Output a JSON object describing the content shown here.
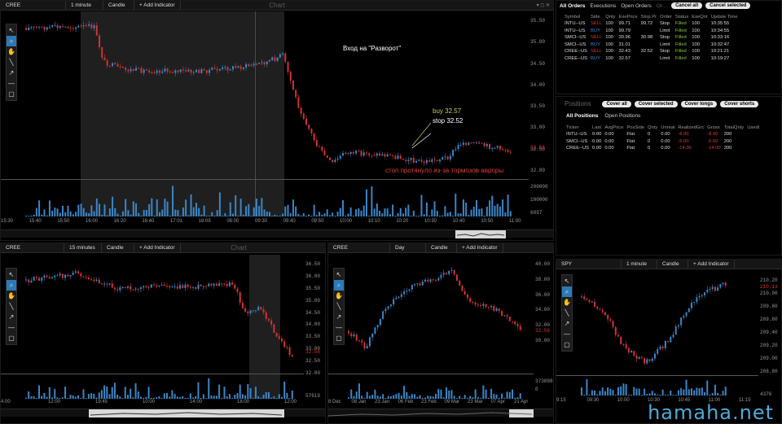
{
  "main_chart": {
    "symbol": "CREE",
    "interval": "1 minute",
    "type": "Candle",
    "add_indicator": "+ Add Indicator",
    "title": "Chart",
    "y_ticks": [
      "35.50",
      "35.00",
      "34.50",
      "34.00",
      "33.50",
      "33.00",
      "32.50",
      "32.00"
    ],
    "last_price": "32.56",
    "vol_ticks": [
      "200000",
      "100000"
    ],
    "vol_last": "6897",
    "x_ticks": [
      "15:30",
      "15:40",
      "15:50",
      "16:00",
      "16:20",
      "16:40",
      "17:01",
      "18:09",
      "08:00",
      "09:30",
      "09:40",
      "09:50",
      "10:00",
      "10:10",
      "10:20",
      "10:30",
      "10:40",
      "10:50",
      "11:00"
    ],
    "annotation_entry": "Вход на \"Разворот\"",
    "annotation_buy": "buy 32.57",
    "annotation_stop": "stop 32.52",
    "annotation_slip": "стоп протянуло из-за тормозов авроры"
  },
  "chart_15m": {
    "symbol": "CREE",
    "interval": "15 minutes",
    "type": "Candle",
    "add_indicator": "+ Add Indicator",
    "title": "Chart",
    "y_ticks": [
      "36.50",
      "36.00",
      "35.50",
      "35.00",
      "34.50",
      "34.00",
      "33.50",
      "33.00",
      "32.50",
      "32.00"
    ],
    "last_price": "32.56",
    "vol_last": "57619",
    "x_ticks": [
      "4:00",
      "12:00",
      "19:45",
      "10:00",
      "14:00",
      "18:00",
      "12:00"
    ]
  },
  "chart_day": {
    "symbol": "CREE",
    "interval": "Day",
    "type": "Candle",
    "add_indicator": "+ Add Indicator",
    "y_ticks": [
      "40.00",
      "38.00",
      "36.00",
      "34.00",
      "32.00",
      "30.00"
    ],
    "last_price": "32.56",
    "vol_ticks": [
      "3738985",
      "0"
    ],
    "x_ticks": [
      "8 Dec",
      "08 Jan",
      "23 Jan",
      "06 Feb",
      "23 Feb",
      "09 Mar",
      "23 Mar",
      "07 Apr",
      "21 Apr"
    ]
  },
  "chart_spy": {
    "symbol": "SPY",
    "interval": "1 minute",
    "type": "Candle",
    "add_indicator": "+ Add Indicator",
    "y_ticks": [
      "210.20",
      "210.00",
      "209.80",
      "209.60",
      "209.40",
      "209.20",
      "209.00",
      "208.80"
    ],
    "last_price": "210.13",
    "vol_last": "4376",
    "x_ticks": [
      "9:15",
      "09:30",
      "10:00",
      "10:30",
      "10:45",
      "11:00",
      "11:15"
    ]
  },
  "orders": {
    "tabs": [
      "All Orders",
      "Executions",
      "Open Orders",
      "Or..."
    ],
    "buttons": [
      "Cancel all",
      "Cancel selected"
    ],
    "headers": [
      "Symbol",
      "Side",
      "Qnty",
      "ExePrice",
      "Stop Pr",
      "Order",
      "Status",
      "ExeQnt",
      "Update Time"
    ],
    "rows": [
      [
        "INTU--US",
        "SELL",
        "100",
        "99.71",
        "99.72",
        "Stop",
        "Filled",
        "100",
        "10:35:55"
      ],
      [
        "INTU--US",
        "BUY",
        "100",
        "99.79",
        "",
        "Limit",
        "Filled",
        "100",
        "10:34:55"
      ],
      [
        "SMCI--US",
        "SELL",
        "100",
        "30.96",
        "30.98",
        "Stop",
        "Filled",
        "100",
        "10:33:16"
      ],
      [
        "SMCI--US",
        "BUY",
        "100",
        "31.01",
        "",
        "Limit",
        "Filled",
        "100",
        "10:32:47"
      ],
      [
        "CREE--US",
        "SELL",
        "100",
        "32.43",
        "32.52",
        "Stop",
        "Filled",
        "100",
        "10:21:21"
      ],
      [
        "CREE--US",
        "BUY",
        "100",
        "32.57",
        "",
        "Limit",
        "Filled",
        "100",
        "10:19:27"
      ]
    ]
  },
  "positions": {
    "title": "Positions",
    "buttons": [
      "Cover all",
      "Cover selected",
      "Cover longs",
      "Cover shorts"
    ],
    "tabs": [
      "All Positions",
      "Open Positions"
    ],
    "headers": [
      "Ticker",
      "Last",
      "AvgPrice",
      "PosSide",
      "Qnty",
      "Unreal",
      "RealizedGrc",
      "Gross",
      "TotalQnty",
      "UsedI"
    ],
    "rows": [
      [
        "INTU--US",
        "0.00",
        "0.00",
        "Flat",
        "0",
        "0.00",
        "-8.00",
        "-8.00",
        "200"
      ],
      [
        "SMCI--US",
        "0.00",
        "0.00",
        "Flat",
        "0",
        "0.00",
        "-5.00",
        "-5.00",
        "200"
      ],
      [
        "CREE--US",
        "0.00",
        "0.00",
        "Flat",
        "0",
        "0.00",
        "-14.00",
        "-14.00",
        "200"
      ]
    ]
  },
  "watermark": "hamaha.net",
  "colors": {
    "up": "#3a86c8",
    "down": "#d33333",
    "accent": "#2a7ab8"
  }
}
